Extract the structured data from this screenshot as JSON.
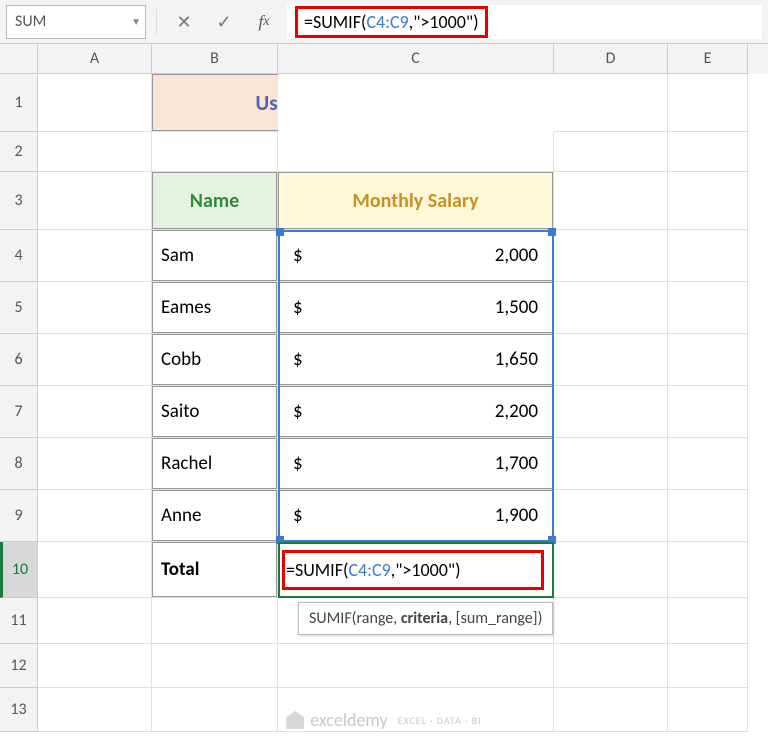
{
  "namebox": "SUM",
  "formula_prefix": "=SUMIF(",
  "formula_ref": "C4:C9",
  "formula_suffix": ",\">1000\")",
  "title": "Use of SUMIF function",
  "headers": {
    "name": "Name",
    "salary": "Monthly Salary"
  },
  "rows": [
    {
      "name": "Sam",
      "cur": "$",
      "val": "2,000"
    },
    {
      "name": "Eames",
      "cur": "$",
      "val": "1,500"
    },
    {
      "name": "Cobb",
      "cur": "$",
      "val": "1,650"
    },
    {
      "name": "Saito",
      "cur": "$",
      "val": "2,200"
    },
    {
      "name": "Rachel",
      "cur": "$",
      "val": "1,700"
    },
    {
      "name": "Anne",
      "cur": "$",
      "val": "1,900"
    }
  ],
  "total_label": "Total",
  "tooltip": {
    "fn": "SUMIF(",
    "a1": "range, ",
    "crit": "criteria",
    "a3": ", [sum_range])"
  },
  "cols": [
    "A",
    "B",
    "C",
    "D",
    "E"
  ],
  "rownums": [
    "1",
    "2",
    "3",
    "4",
    "5",
    "6",
    "7",
    "8",
    "9",
    "10",
    "11",
    "12",
    "13"
  ],
  "watermark": {
    "name": "exceldemy",
    "sub": "EXCEL · DATA · BI"
  }
}
